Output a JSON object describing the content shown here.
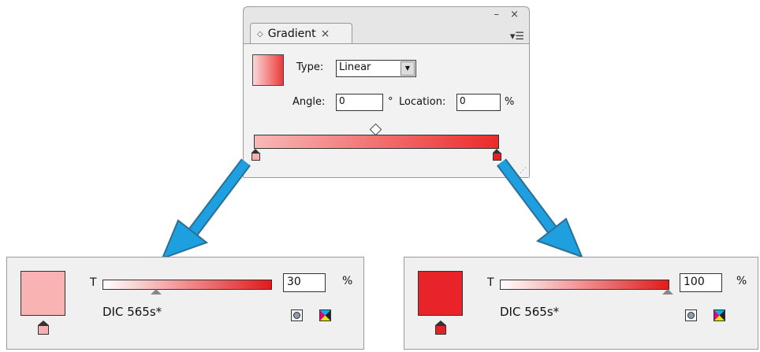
{
  "gradient_panel": {
    "window_controls": "– ×",
    "tab_label": "Gradient",
    "tab_close": "×",
    "tab_icon": "diamond-icon",
    "menu_icon": "panel-menu-icon",
    "type_label": "Type:",
    "type_value": "Linear",
    "angle_label": "Angle:",
    "angle_value": "0",
    "degree_symbol": "°",
    "location_label": "Location:",
    "location_value": "0",
    "percent": "%",
    "ramp_colors": [
      "#f9b8b8",
      "#ec2a2a"
    ],
    "stop_colors": [
      "#f7b0b0",
      "#e52222"
    ]
  },
  "left_swatch_panel": {
    "swatch_color": "#f9b3b3",
    "tint_label": "T",
    "tint_value": "30",
    "percent": "%",
    "swatch_name": "DIC 565s*"
  },
  "right_swatch_panel": {
    "swatch_color": "#e8232a",
    "tint_label": "T",
    "tint_value": "100",
    "percent": "%",
    "swatch_name": "DIC 565s*"
  },
  "arrow_color": "#1e9fe0"
}
